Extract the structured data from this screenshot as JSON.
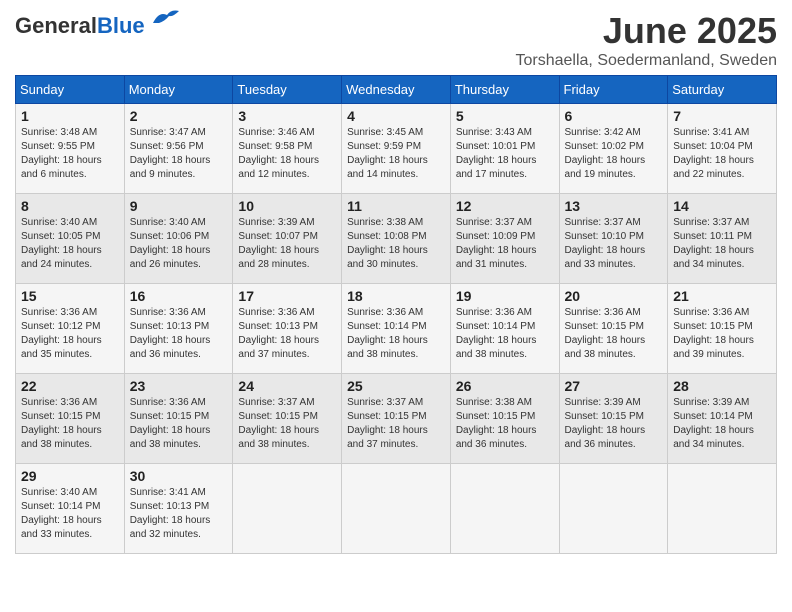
{
  "header": {
    "logo_general": "General",
    "logo_blue": "Blue",
    "month_title": "June 2025",
    "location": "Torshaella, Soedermanland, Sweden"
  },
  "weekdays": [
    "Sunday",
    "Monday",
    "Tuesday",
    "Wednesday",
    "Thursday",
    "Friday",
    "Saturday"
  ],
  "weeks": [
    [
      {
        "day": "1",
        "sunrise": "3:48 AM",
        "sunset": "9:55 PM",
        "daylight": "18 hours and 6 minutes."
      },
      {
        "day": "2",
        "sunrise": "3:47 AM",
        "sunset": "9:56 PM",
        "daylight": "18 hours and 9 minutes."
      },
      {
        "day": "3",
        "sunrise": "3:46 AM",
        "sunset": "9:58 PM",
        "daylight": "18 hours and 12 minutes."
      },
      {
        "day": "4",
        "sunrise": "3:45 AM",
        "sunset": "9:59 PM",
        "daylight": "18 hours and 14 minutes."
      },
      {
        "day": "5",
        "sunrise": "3:43 AM",
        "sunset": "10:01 PM",
        "daylight": "18 hours and 17 minutes."
      },
      {
        "day": "6",
        "sunrise": "3:42 AM",
        "sunset": "10:02 PM",
        "daylight": "18 hours and 19 minutes."
      },
      {
        "day": "7",
        "sunrise": "3:41 AM",
        "sunset": "10:04 PM",
        "daylight": "18 hours and 22 minutes."
      }
    ],
    [
      {
        "day": "8",
        "sunrise": "3:40 AM",
        "sunset": "10:05 PM",
        "daylight": "18 hours and 24 minutes."
      },
      {
        "day": "9",
        "sunrise": "3:40 AM",
        "sunset": "10:06 PM",
        "daylight": "18 hours and 26 minutes."
      },
      {
        "day": "10",
        "sunrise": "3:39 AM",
        "sunset": "10:07 PM",
        "daylight": "18 hours and 28 minutes."
      },
      {
        "day": "11",
        "sunrise": "3:38 AM",
        "sunset": "10:08 PM",
        "daylight": "18 hours and 30 minutes."
      },
      {
        "day": "12",
        "sunrise": "3:37 AM",
        "sunset": "10:09 PM",
        "daylight": "18 hours and 31 minutes."
      },
      {
        "day": "13",
        "sunrise": "3:37 AM",
        "sunset": "10:10 PM",
        "daylight": "18 hours and 33 minutes."
      },
      {
        "day": "14",
        "sunrise": "3:37 AM",
        "sunset": "10:11 PM",
        "daylight": "18 hours and 34 minutes."
      }
    ],
    [
      {
        "day": "15",
        "sunrise": "3:36 AM",
        "sunset": "10:12 PM",
        "daylight": "18 hours and 35 minutes."
      },
      {
        "day": "16",
        "sunrise": "3:36 AM",
        "sunset": "10:13 PM",
        "daylight": "18 hours and 36 minutes."
      },
      {
        "day": "17",
        "sunrise": "3:36 AM",
        "sunset": "10:13 PM",
        "daylight": "18 hours and 37 minutes."
      },
      {
        "day": "18",
        "sunrise": "3:36 AM",
        "sunset": "10:14 PM",
        "daylight": "18 hours and 38 minutes."
      },
      {
        "day": "19",
        "sunrise": "3:36 AM",
        "sunset": "10:14 PM",
        "daylight": "18 hours and 38 minutes."
      },
      {
        "day": "20",
        "sunrise": "3:36 AM",
        "sunset": "10:15 PM",
        "daylight": "18 hours and 38 minutes."
      },
      {
        "day": "21",
        "sunrise": "3:36 AM",
        "sunset": "10:15 PM",
        "daylight": "18 hours and 39 minutes."
      }
    ],
    [
      {
        "day": "22",
        "sunrise": "3:36 AM",
        "sunset": "10:15 PM",
        "daylight": "18 hours and 38 minutes."
      },
      {
        "day": "23",
        "sunrise": "3:36 AM",
        "sunset": "10:15 PM",
        "daylight": "18 hours and 38 minutes."
      },
      {
        "day": "24",
        "sunrise": "3:37 AM",
        "sunset": "10:15 PM",
        "daylight": "18 hours and 38 minutes."
      },
      {
        "day": "25",
        "sunrise": "3:37 AM",
        "sunset": "10:15 PM",
        "daylight": "18 hours and 37 minutes."
      },
      {
        "day": "26",
        "sunrise": "3:38 AM",
        "sunset": "10:15 PM",
        "daylight": "18 hours and 36 minutes."
      },
      {
        "day": "27",
        "sunrise": "3:39 AM",
        "sunset": "10:15 PM",
        "daylight": "18 hours and 36 minutes."
      },
      {
        "day": "28",
        "sunrise": "3:39 AM",
        "sunset": "10:14 PM",
        "daylight": "18 hours and 34 minutes."
      }
    ],
    [
      {
        "day": "29",
        "sunrise": "3:40 AM",
        "sunset": "10:14 PM",
        "daylight": "18 hours and 33 minutes."
      },
      {
        "day": "30",
        "sunrise": "3:41 AM",
        "sunset": "10:13 PM",
        "daylight": "18 hours and 32 minutes."
      },
      null,
      null,
      null,
      null,
      null
    ]
  ],
  "labels": {
    "sunrise_prefix": "Sunrise: ",
    "sunset_prefix": "Sunset: ",
    "daylight_prefix": "Daylight: "
  }
}
